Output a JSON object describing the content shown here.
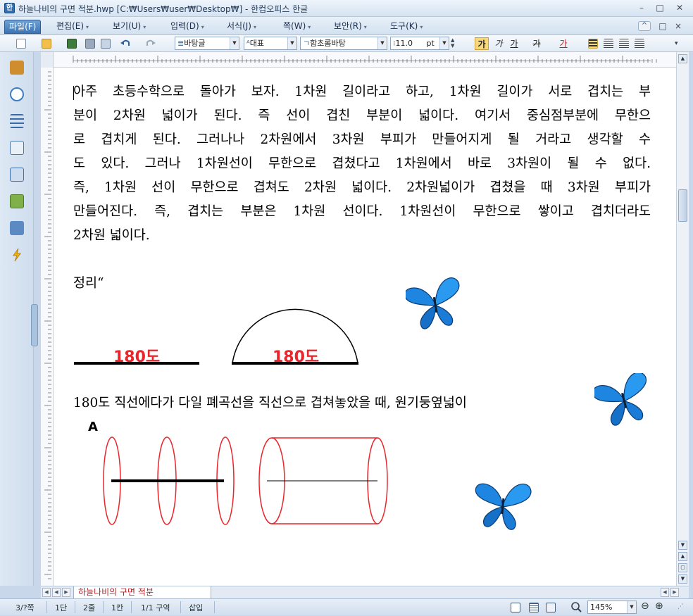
{
  "window": {
    "title": "하늘나비의 구면 적분.hwp [C:₩Users₩user₩Desktop₩] - 한컴오피스 한글",
    "minimize": "–",
    "maximize": "□",
    "close": "✕"
  },
  "menu": {
    "items": [
      {
        "label": "파일(F)"
      },
      {
        "label": "편집(E)"
      },
      {
        "label": "보기(U)"
      },
      {
        "label": "입력(D)"
      },
      {
        "label": "서식(J)"
      },
      {
        "label": "쪽(W)"
      },
      {
        "label": "보안(R)"
      },
      {
        "label": "도구(K)"
      }
    ],
    "right_up": "^",
    "right_restore": "□",
    "right_close": "×"
  },
  "toolbar": {
    "style_combo": "바탕글",
    "rep_combo": "대표",
    "font_combo": "함초롬바탕",
    "size_combo": "11.0",
    "size_unit": "pt",
    "bold": "가",
    "italic": "가",
    "underline": "가",
    "strike": "가",
    "color": "가"
  },
  "document": {
    "paragraph_lines": [
      "아주 초등수학으로 돌아가 보자. 1차원 길이라고 하고, 1차원 길이가 서로 겹치는 부",
      "분이 2차원 넓이가 된다. 즉 선이 겹친 부분이 넓이다. 여기서 중심점부분에 무한으",
      "로 겹치게 된다. 그러나나 2차원에서 3차원 부피가 만들어지게 될 거라고 생각할 수",
      "도 있다. 그러나 1차원선이 무한으로 겹쳤다고 1차원에서 바로 3차원이 될 수 없다.",
      "즉, 1차원 선이 무한으로 겹쳐도 2차원 넓이다. 2차원넓이가 겹쳤을 때 3차원 부피가",
      "만들어진다. 즉, 겹치는 부분은 1차원 선이다. 1차원선이 무한으로 쌓이고 겹치더라도",
      "2차원 넓이다."
    ],
    "heading": "정리“",
    "fig1_label_line": "180도",
    "fig1_label_arc": "180도",
    "caption": "180도 직선에다가 다일 폐곡선을 직선으로 겹쳐놓았을 때, 원기둥옆넓이",
    "fig2_label": "A",
    "colors": {
      "label_red": "#e8262c",
      "ellipse_red": "#e8262c"
    }
  },
  "tab": {
    "doc_name": "하늘나비의 구면 적분"
  },
  "status": {
    "page": "3/?쪽",
    "dan": "1단",
    "line": "2줄",
    "col": "1칸",
    "section": "1/1 구역",
    "mode": "삽입",
    "zoom": "145%"
  }
}
